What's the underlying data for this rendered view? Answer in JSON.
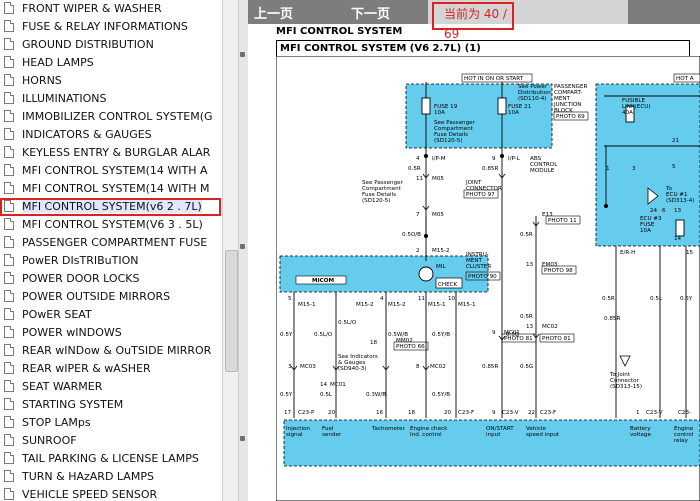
{
  "sidebar": {
    "items": [
      "FRONT WIPER & WASHER",
      "FUSE & RELAY INFORMATIONS",
      "GROUND DISTRIBUTION",
      "HEAD LAMPS",
      "HORNS",
      "ILLUMINATIONS",
      "IMMOBILIZER CONTROL SYSTEM(G",
      "INDICATORS & GAUGES",
      "KEYLESS ENTRY & BURGLAR ALAR",
      "MFI CONTROL SYSTEM(14 WITH A",
      "MFI CONTROL SYSTEM(14 WITH M",
      "MFI CONTROL SYSTEM(v6 2 . 7L)",
      "MFI CONTROL SYSTEM(V6 3 . 5L)",
      "PASSENGER COMPARTMENT FUSE",
      "PowER DIsTRIBuTION",
      "POWER DOOR LOCKS",
      "POWER OUTSIDE MIRRORS",
      "POwER SEAT",
      "POWER wINDOWS",
      "REAR wINDow & OuTSIDE MIRROR",
      "REAR wIPER & wASHER",
      "SEAT WARMER",
      "STARTING SYSTEM",
      "STOP LAMps",
      "SUNROOF",
      "TAIL PARKING & LICENSE LAMPS",
      "TURN & HAzARD LAMPS",
      "VEHICLE SPEED SENSOR"
    ],
    "selected_index": 11
  },
  "toolbar": {
    "prev_label": "上一页",
    "next_label": "下一页",
    "page_indicator": "当前为 40 / 69"
  },
  "document": {
    "header": "MFI CONTROL SYSTEM",
    "subheader": "MFI CONTROL SYSTEM (V6 2.7L) (1)"
  },
  "diagram_text": {
    "hot_in_on_start": "HOT IN ON OR START",
    "hot_at": "HOT A",
    "pdb_l1": "See Power",
    "pdb_l2": "Distribution",
    "pdb_l3": "(SD110-4)",
    "pcjb_1": "PASSENGER",
    "pcjb_2": "COMPART-",
    "pcjb_3": "MENT",
    "pcjb_4": "JUNCTION",
    "pcjb_5": "BLOCK",
    "photo_69": "PHOTO 69",
    "fuse19": "FUSE 19",
    "fuse19_amp": "10A",
    "fuse21": "FUSE 21",
    "fuse21_amp": "10A",
    "pcfd_l1": "See Passenger",
    "pcfd_l2": "Compartment",
    "pcfd_l3": "Fuse Details",
    "pcfd_l4": "(SD120-5)",
    "pcfd2_l4": "(SD120-5)",
    "fusible_l1": "FUSIBLE",
    "fusible_l2": "LINK(ECU)",
    "fusible_l3": "40A",
    "pin_4": "4",
    "ip_m": "I/P-M",
    "pin_9": "9",
    "ip_l": "I/P-L",
    "w_0_5r": "0.5R",
    "w_0_85r": "0.85R",
    "pin_11": "11",
    "m05": "M05",
    "jc_l1": "JOINT",
    "jc_l2": "CONNECTOR",
    "photo_97": "PHOTO 97",
    "abs_l1": "ABS",
    "abs_l2": "CONTROL",
    "abs_l3": "MODULE",
    "e13": "E13",
    "photo_11": "PHOTO 11",
    "pin_7": "7",
    "m05b": "M05",
    "w_0_5b_o": "0.5O/B",
    "w_0_5r2": "0.5R",
    "pin_2": "2",
    "m15_2": "M15-2",
    "ic_l1": "INSTRU-",
    "ic_l2": "MENT",
    "ic_l3": "CLUSTER",
    "photo_90": "PHOTO 90",
    "micom": "MICOM",
    "mil": "MIL",
    "check": "CHECK",
    "em03": "EM03",
    "photo_98": "PHOTO 98",
    "pin_13": "13",
    "pin_5": "5",
    "pin_4b": "4",
    "pin_11b": "11",
    "pin_10": "10",
    "m15_1a": "M15-1",
    "m15_2b": "M15-2",
    "m15_2c": "M15-2",
    "m15_1b": "M15-1",
    "m15_1c": "M15-1",
    "w_0_5l_o": "0.5L/O",
    "w_0_5y": "0.5Y",
    "w_0_5w_b": "0.5W/B",
    "w_0_5y_b": "0.5Y/B",
    "w_0_5g": "0.5G",
    "w_0_5r3": "0.5R",
    "pin_18": "18",
    "mm02": "MM02",
    "photo_66": "PHOTO 66",
    "w_0_5l_o2": "0.5L/O",
    "ind_l1": "See Indicators",
    "ind_l2": "& Gauges",
    "ind_l3": "(SD940-3)",
    "pin_3": "3",
    "mc03": "MC03",
    "pin_9b": "9",
    "pin_13b": "13",
    "mc01": "MC01",
    "photo_81": "PHOTO 81",
    "mc02": "MC02",
    "photo_81b": "PHOTO 81",
    "pin_14": "14",
    "mc01b": "MC01",
    "pin_8": "8",
    "mc02b": "MC02",
    "w_0_5y2": "0.5Y",
    "w_0_5l": "0.5L",
    "w_0_3w_b": "0.3W/B",
    "w_0_5y_b2": "0.5Y/B",
    "w_0_85r2": "0.85R",
    "w_0_5g2": "0.5G",
    "pin_17": "17",
    "c23_p": "C23-P",
    "pin_20": "20",
    "pin_16": "16",
    "pin_18b": "18",
    "pin_20b": "20",
    "c23_f": "C23-F",
    "pin_9c": "9",
    "c23_v": "C23-V",
    "pin_22": "22",
    "c23_f2": "C23-F",
    "sig_1a": "Injection",
    "sig_1b": "signal",
    "sig_2a": "Fuel",
    "sig_2b": "sender",
    "sig_3": "Tachometer",
    "sig_4a": "Engine check",
    "sig_4b": "Ind. control",
    "sig_5a": "ON/START",
    "sig_5b": "input",
    "sig_6a": "Vehicle",
    "sig_6b": "speed input",
    "ecu_to_1": "To",
    "ecu_to_2": "ECU #1",
    "ecu_to_3": "(SD313-4)",
    "ecu3_l1": "ECU #3",
    "ecu3_l2": "FUSE",
    "ecu3_l3": "10A",
    "pin_21": "21",
    "pin_5b": "5",
    "pin_1": "1",
    "rpin_3": "3",
    "pin_24": "24",
    "pin_6": "6",
    "pin_13c": "13",
    "pin_14b": "14",
    "pin_15": "15",
    "er_h": "E/R-H",
    "w_0_5r4": "0.5R",
    "w_0_5l2": "0.5L",
    "w_0_5y3": "0.5Y",
    "w_0_85r3": "0.85R",
    "joint_l1": "To Joint",
    "joint_l2": "Connector",
    "joint_l3": "(SD313-15)",
    "pin_1b": "1",
    "c23_v2": "C23-V",
    "c23_p2": "C23-",
    "bat_l1": "Battery",
    "bat_l2": "voltage",
    "relay_l1": "Engine",
    "relay_l2": "control",
    "relay_l3": "relay"
  }
}
